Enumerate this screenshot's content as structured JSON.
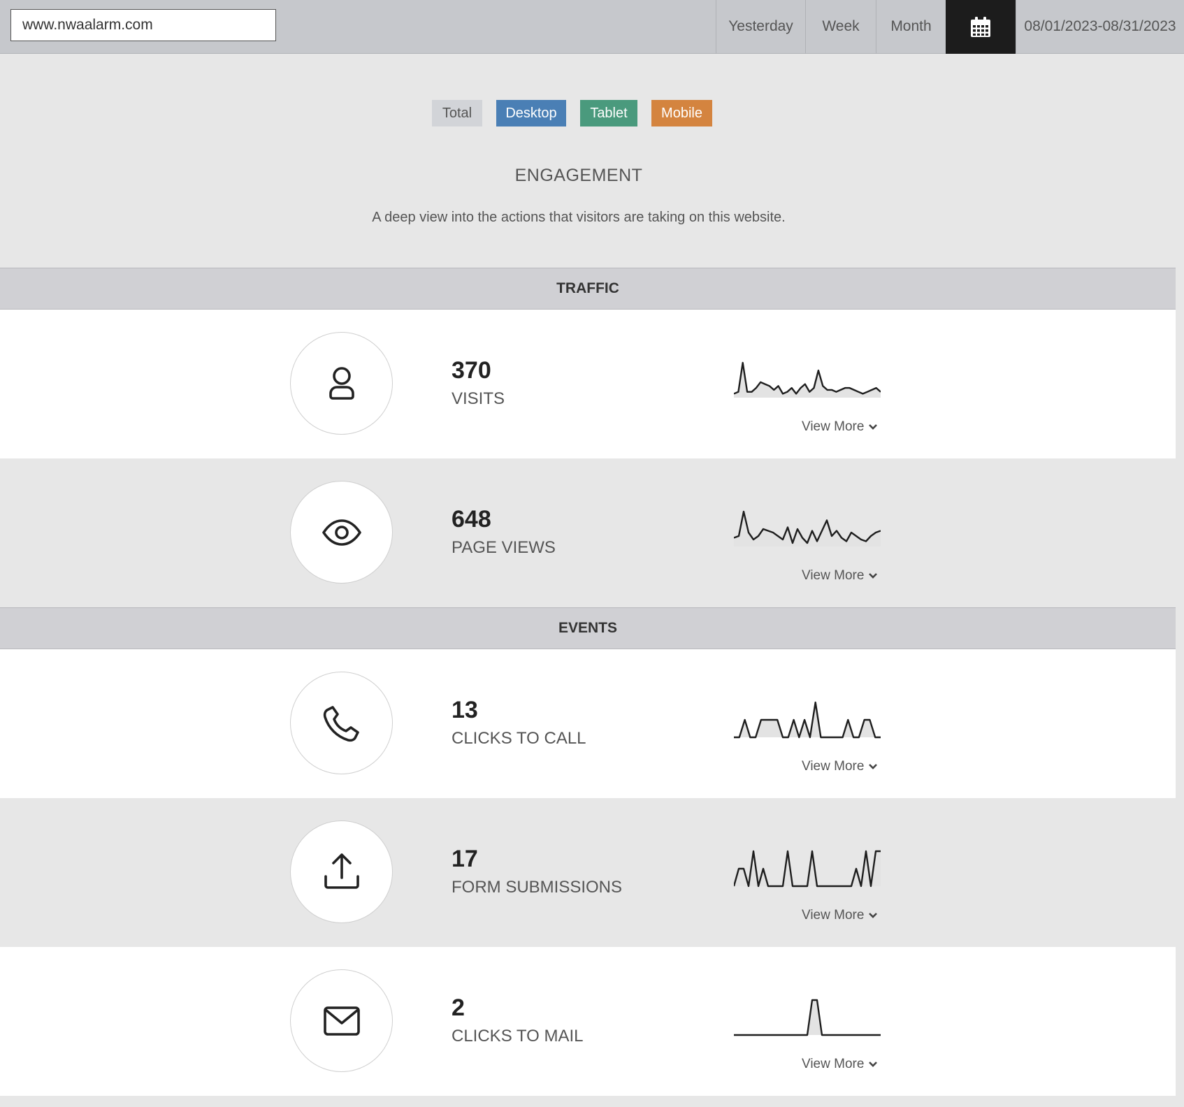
{
  "topbar": {
    "site_value": "www.nwaalarm.com",
    "ranges": [
      "Yesterday",
      "Week",
      "Month"
    ],
    "calendar_icon": "calendar-icon",
    "date_range": "08/01/2023-08/31/2023"
  },
  "filters": {
    "total": "Total",
    "desktop": "Desktop",
    "tablet": "Tablet",
    "mobile": "Mobile",
    "colors": {
      "total": "#d2d4d8",
      "desktop": "#4a7fb5",
      "tablet": "#4a9a7d",
      "mobile": "#d4843f"
    }
  },
  "header": {
    "title": "ENGAGEMENT",
    "description": "A deep view into the actions that visitors are taking on this website."
  },
  "sections": {
    "traffic": "TRAFFIC",
    "events": "EVENTS"
  },
  "view_more": "View More",
  "metrics": [
    {
      "value": "370",
      "label": "VISITS",
      "icon": "user-icon",
      "trend": [
        2,
        3,
        18,
        3,
        3,
        5,
        8,
        7,
        6,
        4,
        6,
        2,
        3,
        5,
        2,
        5,
        7,
        3,
        5,
        14,
        6,
        4,
        4,
        3,
        4,
        5,
        5,
        4,
        3,
        2,
        3,
        4,
        5,
        3
      ]
    },
    {
      "value": "648",
      "label": "PAGE VIEWS",
      "icon": "eye-icon",
      "trend": [
        5,
        6,
        20,
        8,
        4,
        6,
        10,
        9,
        8,
        6,
        4,
        11,
        2,
        10,
        5,
        2,
        9,
        3,
        9,
        15,
        6,
        9,
        5,
        3,
        8,
        6,
        4,
        3,
        6,
        8,
        9
      ]
    },
    {
      "value": "13",
      "label": "CLICKS TO CALL",
      "icon": "phone-icon",
      "trend": [
        0,
        0,
        1,
        0,
        0,
        1,
        1,
        1,
        1,
        0,
        0,
        1,
        0,
        1,
        0,
        2,
        0,
        0,
        0,
        0,
        0,
        1,
        0,
        0,
        1,
        1,
        0,
        0
      ]
    },
    {
      "value": "17",
      "label": "FORM SUBMISSIONS",
      "icon": "upload-icon",
      "trend": [
        0,
        1,
        1,
        0,
        2,
        0,
        1,
        0,
        0,
        0,
        0,
        2,
        0,
        0,
        0,
        0,
        2,
        0,
        0,
        0,
        0,
        0,
        0,
        0,
        0,
        1,
        0,
        2,
        0,
        2,
        2
      ]
    },
    {
      "value": "2",
      "label": "CLICKS TO MAIL",
      "icon": "mail-icon",
      "trend": [
        0,
        0,
        0,
        0,
        0,
        0,
        0,
        0,
        0,
        0,
        0,
        0,
        0,
        0,
        0,
        0,
        2,
        2,
        0,
        0,
        0,
        0,
        0,
        0,
        0,
        0,
        0,
        0,
        0,
        0,
        0
      ]
    }
  ]
}
